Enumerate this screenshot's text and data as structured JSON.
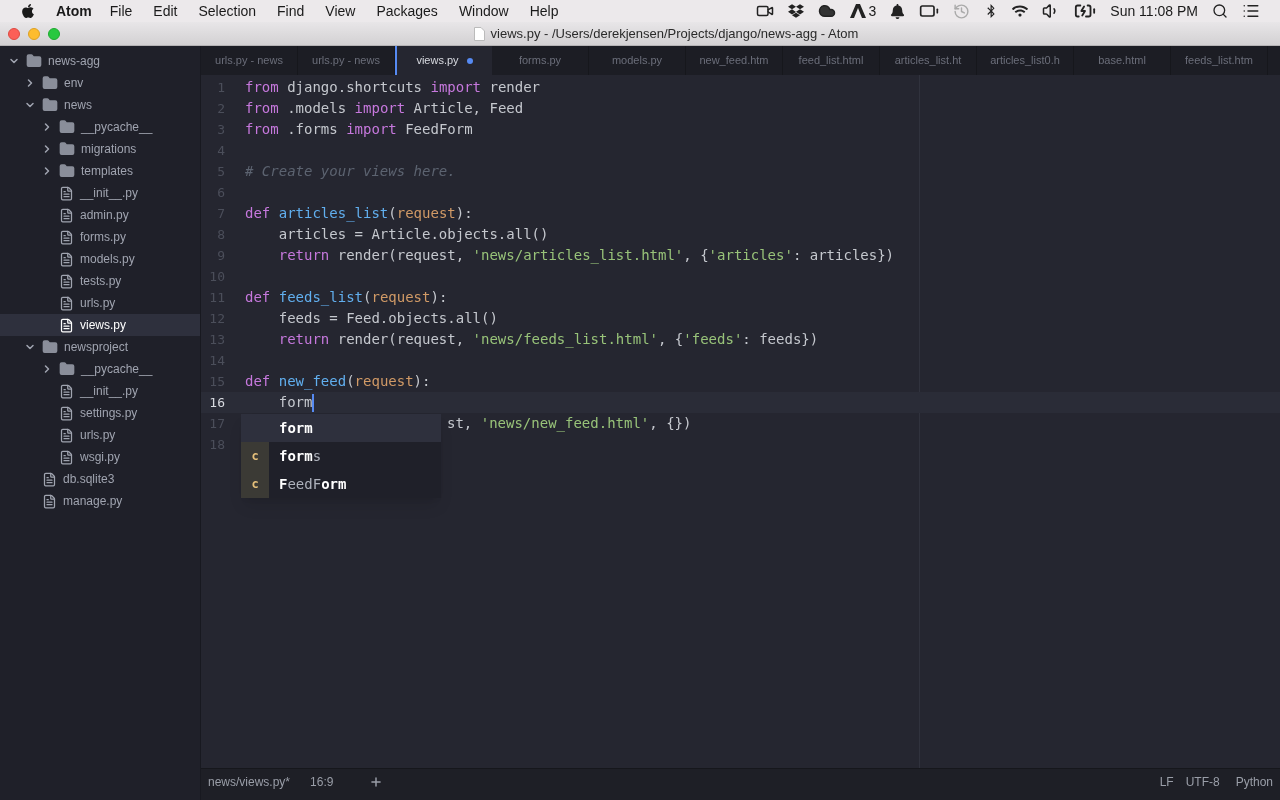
{
  "menu_bar": {
    "app": "Atom",
    "items": [
      "File",
      "Edit",
      "Selection",
      "Find",
      "View",
      "Packages",
      "Window",
      "Help"
    ],
    "adobe_count": "3",
    "clock": "Sun 11:08 PM"
  },
  "window": {
    "title": "views.py - /Users/derekjensen/Projects/django/news-agg - Atom"
  },
  "tabs": [
    {
      "label": "urls.py - news",
      "selected": false,
      "modified": false
    },
    {
      "label": "urls.py - news",
      "selected": false,
      "modified": false
    },
    {
      "label": "views.py",
      "selected": true,
      "modified": true
    },
    {
      "label": "forms.py",
      "selected": false,
      "modified": false
    },
    {
      "label": "models.py",
      "selected": false,
      "modified": false
    },
    {
      "label": "new_feed.htm",
      "selected": false,
      "modified": false
    },
    {
      "label": "feed_list.html",
      "selected": false,
      "modified": false
    },
    {
      "label": "articles_list.ht",
      "selected": false,
      "modified": false
    },
    {
      "label": "articles_list0.h",
      "selected": false,
      "modified": false
    },
    {
      "label": "base.html",
      "selected": false,
      "modified": false
    },
    {
      "label": "feeds_list.htm",
      "selected": false,
      "modified": false
    }
  ],
  "tree": [
    {
      "name": "news-agg",
      "kind": "folder",
      "expanded": true,
      "selected": false,
      "children": [
        {
          "name": "env",
          "kind": "folder",
          "expanded": false,
          "selected": false
        },
        {
          "name": "news",
          "kind": "folder",
          "expanded": true,
          "selected": false,
          "children": [
            {
              "name": "__pycache__",
              "kind": "folder",
              "expanded": false,
              "selected": false
            },
            {
              "name": "migrations",
              "kind": "folder",
              "expanded": false,
              "selected": false
            },
            {
              "name": "templates",
              "kind": "folder",
              "expanded": false,
              "selected": false
            },
            {
              "name": "__init__.py",
              "kind": "file",
              "selected": false
            },
            {
              "name": "admin.py",
              "kind": "file",
              "selected": false
            },
            {
              "name": "forms.py",
              "kind": "file",
              "selected": false
            },
            {
              "name": "models.py",
              "kind": "file",
              "selected": false
            },
            {
              "name": "tests.py",
              "kind": "file",
              "selected": false
            },
            {
              "name": "urls.py",
              "kind": "file",
              "selected": false
            },
            {
              "name": "views.py",
              "kind": "file",
              "selected": true
            }
          ]
        },
        {
          "name": "newsproject",
          "kind": "folder",
          "expanded": true,
          "selected": false,
          "children": [
            {
              "name": "__pycache__",
              "kind": "folder",
              "expanded": false,
              "selected": false
            },
            {
              "name": "__init__.py",
              "kind": "file",
              "selected": false
            },
            {
              "name": "settings.py",
              "kind": "file",
              "selected": false
            },
            {
              "name": "urls.py",
              "kind": "file",
              "selected": false
            },
            {
              "name": "wsgi.py",
              "kind": "file",
              "selected": false
            }
          ]
        },
        {
          "name": "db.sqlite3",
          "kind": "file",
          "selected": false
        },
        {
          "name": "manage.py",
          "kind": "file",
          "selected": false
        }
      ]
    }
  ],
  "editor": {
    "lines": [
      {
        "number": "1",
        "current": false,
        "kind": "full",
        "tokens": [
          {
            "text": "from ",
            "kind": "keyword"
          },
          {
            "text": "django.shortcuts ",
            "kind": "plain"
          },
          {
            "text": "import ",
            "kind": "keyword"
          },
          {
            "text": "render",
            "kind": "plain"
          }
        ]
      },
      {
        "number": "2",
        "current": false,
        "kind": "full",
        "tokens": [
          {
            "text": "from ",
            "kind": "keyword"
          },
          {
            "text": ".models ",
            "kind": "plain"
          },
          {
            "text": "import ",
            "kind": "keyword"
          },
          {
            "text": "Article, Feed",
            "kind": "plain"
          }
        ]
      },
      {
        "number": "3",
        "current": false,
        "kind": "full",
        "tokens": [
          {
            "text": "from ",
            "kind": "keyword"
          },
          {
            "text": ".forms ",
            "kind": "plain"
          },
          {
            "text": "import ",
            "kind": "keyword"
          },
          {
            "text": "FeedForm",
            "kind": "plain"
          }
        ]
      },
      {
        "number": "4",
        "current": false,
        "kind": "full"
      },
      {
        "number": "5",
        "current": false,
        "kind": "full",
        "tokens": [
          {
            "text": "# Create your views here.",
            "kind": "comment"
          }
        ]
      },
      {
        "number": "6",
        "current": false,
        "kind": "full"
      },
      {
        "number": "7",
        "current": false,
        "kind": "full",
        "tokens": [
          {
            "text": "def ",
            "kind": "keyword"
          },
          {
            "text": "articles_list",
            "kind": "function"
          },
          {
            "text": "(",
            "kind": "plain"
          },
          {
            "text": "request",
            "kind": "param"
          },
          {
            "text": "):",
            "kind": "plain"
          }
        ]
      },
      {
        "number": "8",
        "current": false,
        "kind": "full",
        "tokens": [
          {
            "text": "    articles = Article.objects.all()",
            "kind": "plain"
          }
        ]
      },
      {
        "number": "9",
        "current": false,
        "kind": "full",
        "tokens": [
          {
            "text": "    return ",
            "kind": "keyword"
          },
          {
            "text": "render(request, ",
            "kind": "plain"
          },
          {
            "text": "'news/articles_list.html'",
            "kind": "string"
          },
          {
            "text": ", {",
            "kind": "plain"
          },
          {
            "text": "'articles'",
            "kind": "string"
          },
          {
            "text": ": articles})",
            "kind": "plain"
          }
        ]
      },
      {
        "number": "10",
        "current": false,
        "kind": "full"
      },
      {
        "number": "11",
        "current": false,
        "kind": "full",
        "tokens": [
          {
            "text": "def ",
            "kind": "keyword"
          },
          {
            "text": "feeds_list",
            "kind": "function"
          },
          {
            "text": "(",
            "kind": "plain"
          },
          {
            "text": "request",
            "kind": "param"
          },
          {
            "text": "):",
            "kind": "plain"
          }
        ]
      },
      {
        "number": "12",
        "current": false,
        "kind": "full",
        "tokens": [
          {
            "text": "    feeds = Feed.objects.all()",
            "kind": "plain"
          }
        ]
      },
      {
        "number": "13",
        "current": false,
        "kind": "full",
        "tokens": [
          {
            "text": "    return ",
            "kind": "keyword"
          },
          {
            "text": "render(request, ",
            "kind": "plain"
          },
          {
            "text": "'news/feeds_list.html'",
            "kind": "string"
          },
          {
            "text": ", {",
            "kind": "plain"
          },
          {
            "text": "'feeds'",
            "kind": "string"
          },
          {
            "text": ": feeds})",
            "kind": "plain"
          }
        ]
      },
      {
        "number": "14",
        "current": false,
        "kind": "full"
      },
      {
        "number": "15",
        "current": false,
        "kind": "full",
        "tokens": [
          {
            "text": "def ",
            "kind": "keyword"
          },
          {
            "text": "new_feed",
            "kind": "function"
          },
          {
            "text": "(",
            "kind": "plain"
          },
          {
            "text": "request",
            "kind": "param"
          },
          {
            "text": "):",
            "kind": "plain"
          }
        ]
      },
      {
        "number": "16",
        "current": true,
        "kind": "full",
        "tokens": [
          {
            "text": "    form",
            "kind": "plain"
          }
        ]
      },
      {
        "number": "17",
        "current": false,
        "kind": "partial",
        "tokens": [
          {
            "text": "st, ",
            "kind": "plain"
          },
          {
            "text": "'news/new_feed.html'",
            "kind": "string"
          },
          {
            "text": ", {})",
            "kind": "plain"
          }
        ]
      },
      {
        "number": "18",
        "current": false,
        "kind": "full"
      }
    ],
    "autocomplete": [
      {
        "text": "**form**",
        "selected": true
      },
      {
        "type": "c",
        "text": "**form**s",
        "selected": false
      },
      {
        "type": "c",
        "text": "**F**eedF**orm**",
        "selected": false
      }
    ]
  },
  "status_bar": {
    "file": "news/views.py*",
    "cursor": "16:9",
    "line_ending": "LF",
    "encoding": "UTF-8",
    "grammar": "Python"
  }
}
